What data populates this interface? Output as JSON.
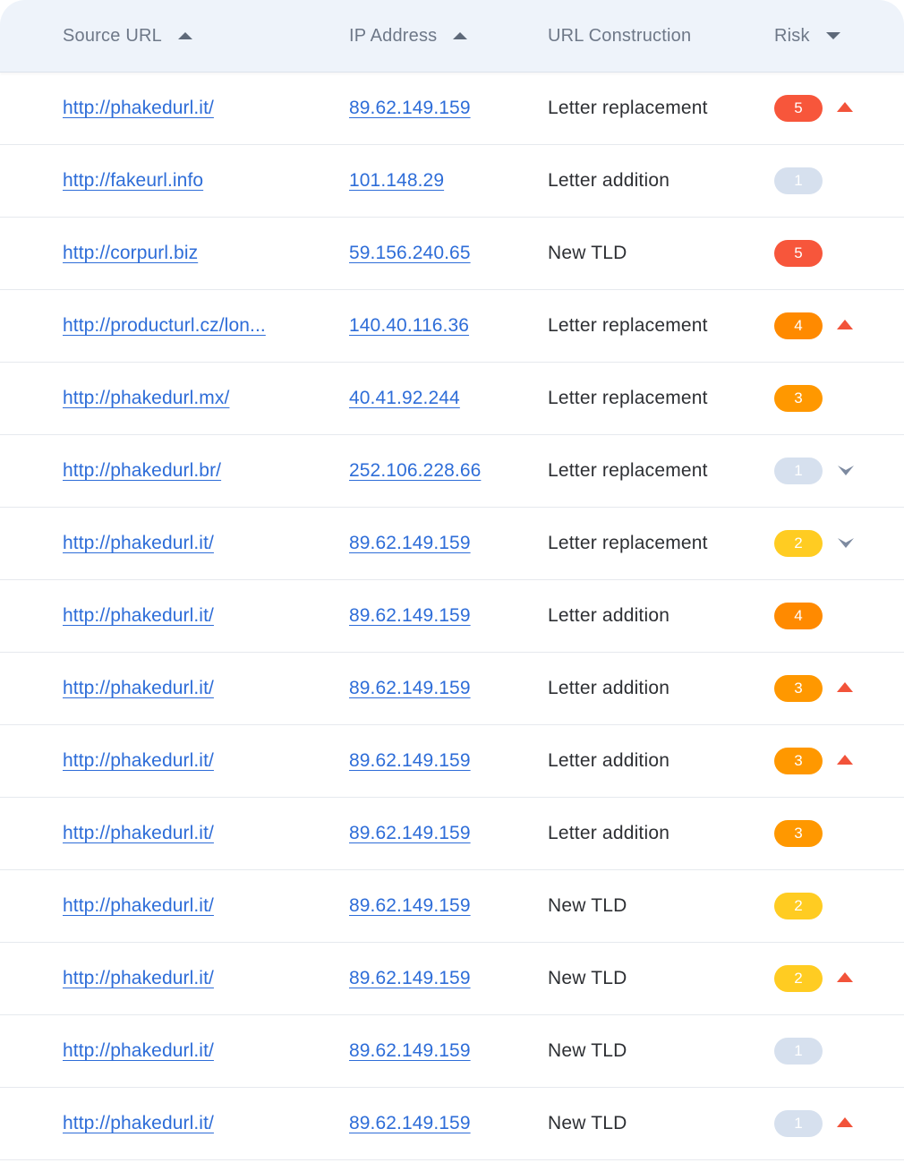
{
  "columns": {
    "source": "Source URL",
    "ip": "IP Address",
    "construction": "URL Construction",
    "risk": "Risk"
  },
  "risk_colors": {
    "5": "#f7563b",
    "4": "#ff8a00",
    "3": "#ff9800",
    "2": "#ffcc22",
    "1": "#d6e0ee"
  },
  "trend_colors": {
    "up": "#f2533a",
    "down": "#7d8aa0"
  },
  "rows": [
    {
      "url": "http://phakedurl.it/",
      "ip": "89.62.149.159",
      "construction": "Letter replacement",
      "risk": "5",
      "trend": "up"
    },
    {
      "url": "http://fakeurl.info",
      "ip": "101.148.29",
      "construction": "Letter addition",
      "risk": "1",
      "trend": "none"
    },
    {
      "url": "http://corpurl.biz",
      "ip": "59.156.240.65",
      "construction": "New TLD",
      "risk": "5",
      "trend": "none"
    },
    {
      "url": "http://producturl.cz/lon...",
      "ip": "140.40.116.36",
      "construction": "Letter replacement",
      "risk": "4",
      "trend": "up"
    },
    {
      "url": "http://phakedurl.mx/",
      "ip": "40.41.92.244",
      "construction": "Letter replacement",
      "risk": "3",
      "trend": "none"
    },
    {
      "url": "http://phakedurl.br/",
      "ip": "252.106.228.66",
      "construction": "Letter replacement",
      "risk": "1",
      "trend": "down"
    },
    {
      "url": "http://phakedurl.it/",
      "ip": "89.62.149.159",
      "construction": "Letter replacement",
      "risk": "2",
      "trend": "down"
    },
    {
      "url": "http://phakedurl.it/",
      "ip": "89.62.149.159",
      "construction": "Letter addition",
      "risk": "4",
      "trend": "none"
    },
    {
      "url": "http://phakedurl.it/",
      "ip": "89.62.149.159",
      "construction": "Letter addition",
      "risk": "3",
      "trend": "up"
    },
    {
      "url": "http://phakedurl.it/",
      "ip": "89.62.149.159",
      "construction": "Letter addition",
      "risk": "3",
      "trend": "up"
    },
    {
      "url": "http://phakedurl.it/",
      "ip": "89.62.149.159",
      "construction": "Letter addition",
      "risk": "3",
      "trend": "none"
    },
    {
      "url": "http://phakedurl.it/",
      "ip": "89.62.149.159",
      "construction": "New TLD",
      "risk": "2",
      "trend": "none"
    },
    {
      "url": "http://phakedurl.it/",
      "ip": "89.62.149.159",
      "construction": "New TLD",
      "risk": "2",
      "trend": "up"
    },
    {
      "url": "http://phakedurl.it/",
      "ip": "89.62.149.159",
      "construction": "New TLD",
      "risk": "1",
      "trend": "none"
    },
    {
      "url": "http://phakedurl.it/",
      "ip": "89.62.149.159",
      "construction": "New TLD",
      "risk": "1",
      "trend": "up"
    }
  ]
}
